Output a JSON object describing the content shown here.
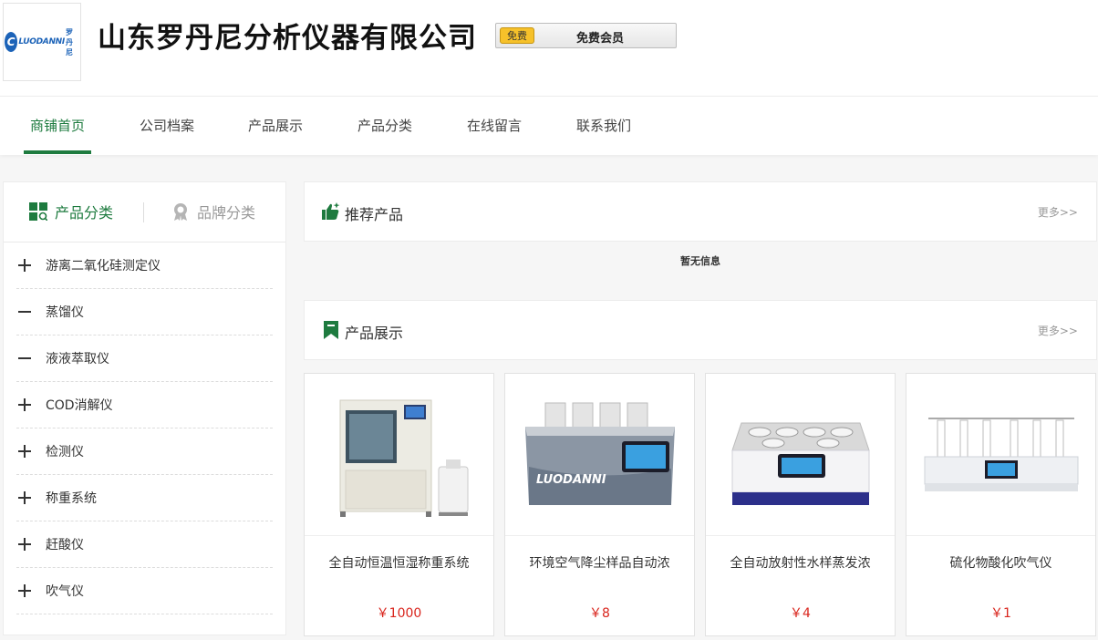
{
  "header": {
    "logo_text": "LUODANNI",
    "logo_cn": "罗丹尼",
    "company_name": "山东罗丹尼分析仪器有限公司",
    "free_badge": "免费",
    "member_label": "免费会员"
  },
  "nav": {
    "items": [
      "商铺首页",
      "公司档案",
      "产品展示",
      "产品分类",
      "在线留言",
      "联系我们"
    ],
    "active_index": 0
  },
  "sidebar": {
    "tab_product": "产品分类",
    "tab_brand": "品牌分类",
    "categories": [
      {
        "label": "游离二氧化硅测定仪",
        "state": "plus"
      },
      {
        "label": "蒸馏仪",
        "state": "minus"
      },
      {
        "label": "液液萃取仪",
        "state": "minus"
      },
      {
        "label": "COD消解仪",
        "state": "plus"
      },
      {
        "label": "检测仪",
        "state": "plus"
      },
      {
        "label": "称重系统",
        "state": "plus"
      },
      {
        "label": "赶酸仪",
        "state": "plus"
      },
      {
        "label": "吹气仪",
        "state": "plus"
      }
    ]
  },
  "recommend": {
    "title": "推荐产品",
    "more": "更多>>",
    "empty": "暂无信息"
  },
  "showcase": {
    "title": "产品展示",
    "more": "更多>>",
    "products": [
      {
        "name": "全自动恒温恒湿称重系统",
        "price": "￥1000"
      },
      {
        "name": "环境空气降尘样品自动浓",
        "price": "￥8"
      },
      {
        "name": "全自动放射性水样蒸发浓",
        "price": "￥4"
      },
      {
        "name": "硫化物酸化吹气仪",
        "price": "￥1"
      }
    ]
  },
  "colors": {
    "accent": "#1e7b3f",
    "price": "#d9251d",
    "brand_blue": "#1c63b8"
  }
}
